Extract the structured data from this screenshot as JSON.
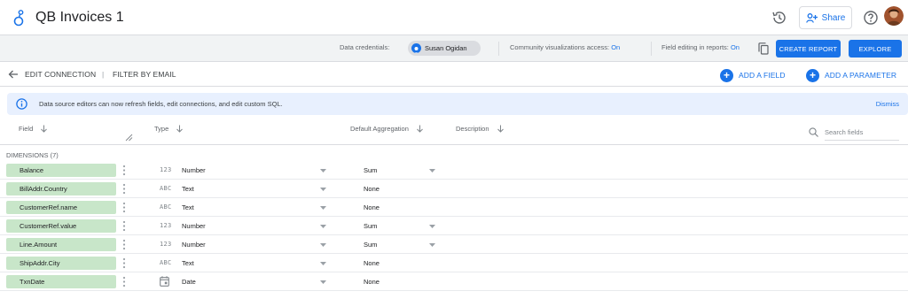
{
  "app": {
    "title": "QB Invoices 1"
  },
  "header": {
    "share_label": "Share"
  },
  "credentials_bar": {
    "data_credentials_label": "Data credentials:",
    "credential_owner": "Susan Ogidan",
    "community_label": "Community visualizations access:",
    "community_value": "On",
    "field_editing_label": "Field editing in reports:",
    "field_editing_value": "On",
    "create_report_label": "CREATE REPORT",
    "explore_label": "EXPLORE"
  },
  "edit_row": {
    "edit_connection_label": "EDIT CONNECTION",
    "separator": "|",
    "filter_by_email_label": "FILTER BY EMAIL",
    "add_field_label": "ADD A FIELD",
    "add_parameter_label": "ADD A PARAMETER"
  },
  "banner": {
    "text": "Data source editors can now refresh fields, edit connections, and edit custom SQL.",
    "dismiss_label": "Dismiss"
  },
  "columns": {
    "field": "Field",
    "type": "Type",
    "default_aggregation": "Default Aggregation",
    "description": "Description",
    "search_placeholder": "Search fields"
  },
  "dimensions": {
    "label": "DIMENSIONS (7)",
    "rows": [
      {
        "field": "Balance",
        "type_icon": "123",
        "type": "Number",
        "aggregation": "Sum",
        "has_agg_dropdown": true
      },
      {
        "field": "BillAddr.Country",
        "type_icon": "ABC",
        "type": "Text",
        "aggregation": "None",
        "has_agg_dropdown": false
      },
      {
        "field": "CustomerRef.name",
        "type_icon": "ABC",
        "type": "Text",
        "aggregation": "None",
        "has_agg_dropdown": false
      },
      {
        "field": "CustomerRef.value",
        "type_icon": "123",
        "type": "Number",
        "aggregation": "Sum",
        "has_agg_dropdown": true
      },
      {
        "field": "Line.Amount",
        "type_icon": "123",
        "type": "Number",
        "aggregation": "Sum",
        "has_agg_dropdown": true
      },
      {
        "field": "ShipAddr.City",
        "type_icon": "ABC",
        "type": "Text",
        "aggregation": "None",
        "has_agg_dropdown": false
      },
      {
        "field": "TxnDate",
        "type_icon": "calendar-icon",
        "type": "Date",
        "aggregation": "None",
        "has_agg_dropdown": false
      }
    ]
  },
  "colors": {
    "accent": "#1a73e8",
    "dimension_chip": "#c8e6c9",
    "banner_bg": "#e8f0fe",
    "credentials_bg": "#f1f3f4"
  }
}
